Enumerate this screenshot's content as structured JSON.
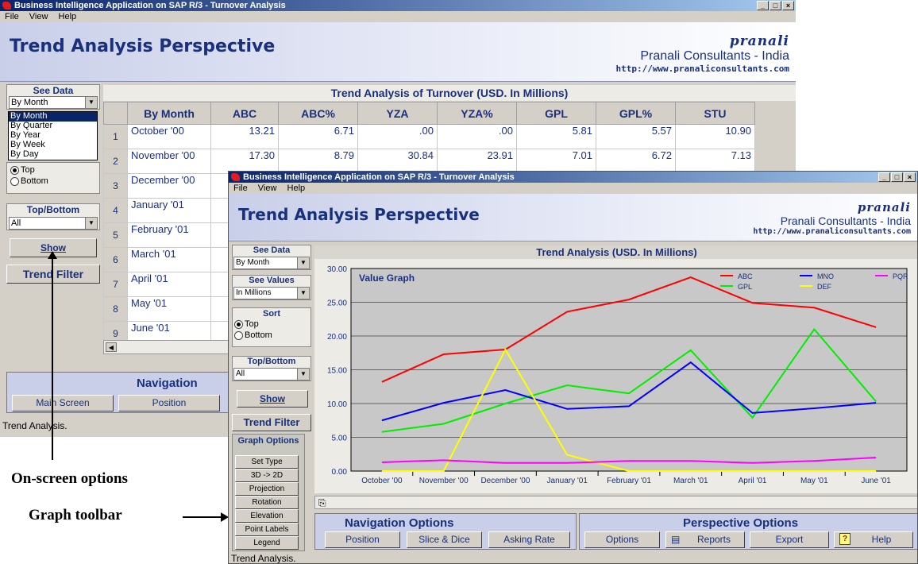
{
  "window_title": "Business Intelligence Application on SAP R/3 - Turnover Analysis",
  "menu": [
    "File",
    "View",
    "Help"
  ],
  "page_title": "Trend Analysis Perspective",
  "brand": {
    "logo": "pranali",
    "company": "Pranali Consultants - India",
    "url": "http://www.pranaliconsultants.com"
  },
  "sidebar": {
    "see_data_label": "See Data",
    "see_data_value": "By Month",
    "see_data_options": [
      "By Month",
      "By Quarter",
      "By Year",
      "By Week",
      "By Day"
    ],
    "see_values_label": "See Values",
    "see_values_value": "In Millions",
    "sort_label": "Sort",
    "sort_top": "Top",
    "sort_bottom": "Bottom",
    "topbottom_label": "Top/Bottom",
    "topbottom_value": "All",
    "show_label": "Show",
    "trend_filter_label": "Trend Filter",
    "graph_options_label": "Graph Options",
    "graph_buttons": [
      "Set Type",
      "3D -> 2D",
      "Projection",
      "Rotation",
      "Elevation",
      "Point Labels",
      "Legend"
    ]
  },
  "grid": {
    "title": "Trend Analysis of Turnover (USD. In Millions)",
    "headers": [
      "By Month",
      "ABC",
      "ABC%",
      "YZA",
      "YZA%",
      "GPL",
      "GPL%",
      "STU"
    ],
    "rows": [
      {
        "n": "1",
        "month": "October '00",
        "values": [
          "13.21",
          "6.71",
          ".00",
          ".00",
          "5.81",
          "5.57",
          "10.90"
        ]
      },
      {
        "n": "2",
        "month": "November '00",
        "values": [
          "17.30",
          "8.79",
          "30.84",
          "23.91",
          "7.01",
          "6.72",
          "7.13"
        ]
      },
      {
        "n": "3",
        "month": "December '00",
        "values": []
      },
      {
        "n": "4",
        "month": "January '01",
        "values": []
      },
      {
        "n": "5",
        "month": "February '01",
        "values": []
      },
      {
        "n": "6",
        "month": "March '01",
        "values": []
      },
      {
        "n": "7",
        "month": "April '01",
        "values": []
      },
      {
        "n": "8",
        "month": "May '01",
        "values": []
      },
      {
        "n": "9",
        "month": "June '01",
        "values": []
      }
    ]
  },
  "nav": {
    "header": "Navigation Options",
    "header_short": "Navigation",
    "buttons": [
      "Main Screen",
      "Position",
      "Slice & Dice",
      "Asking Rate"
    ],
    "perspective_header": "Perspective Options",
    "perspective_buttons": [
      "Options",
      "Reports",
      "Export",
      "Help"
    ]
  },
  "status_text": "Trend Analysis.",
  "annotations": {
    "onscreen": "On-screen options",
    "toolbar": "Graph toolbar"
  },
  "chart_data": {
    "type": "line",
    "title": "Trend Analysis (USD. In Millions)",
    "graph_label": "Value Graph",
    "categories": [
      "October '00",
      "November '00",
      "December '00",
      "January '01",
      "February '01",
      "March '01",
      "April '01",
      "May '01",
      "June '01"
    ],
    "ylim": [
      0,
      30
    ],
    "yticks": [
      "0.00",
      "5.00",
      "10.00",
      "15.00",
      "20.00",
      "25.00",
      "30.00"
    ],
    "grid": true,
    "legend_position": "top-right",
    "series": [
      {
        "name": "ABC",
        "color": "#ff0000",
        "values": [
          13.2,
          17.3,
          18.0,
          23.6,
          25.4,
          28.7,
          24.9,
          24.2,
          21.3
        ]
      },
      {
        "name": "GPL",
        "color": "#00ee00",
        "values": [
          5.8,
          7.0,
          10.0,
          12.7,
          11.5,
          17.9,
          7.9,
          21.0,
          10.3
        ]
      },
      {
        "name": "MNO",
        "color": "#0000ff",
        "values": [
          7.5,
          10.1,
          12.0,
          9.2,
          9.6,
          16.1,
          8.6,
          9.3,
          10.1
        ]
      },
      {
        "name": "DEF",
        "color": "#ffff00",
        "values": [
          0,
          0,
          18.0,
          2.4,
          0,
          0,
          0,
          0,
          0
        ]
      },
      {
        "name": "PQR",
        "color": "#ff00ff",
        "values": [
          1.3,
          1.6,
          1.2,
          1.2,
          1.5,
          1.5,
          1.2,
          1.5,
          2.0
        ]
      }
    ]
  }
}
